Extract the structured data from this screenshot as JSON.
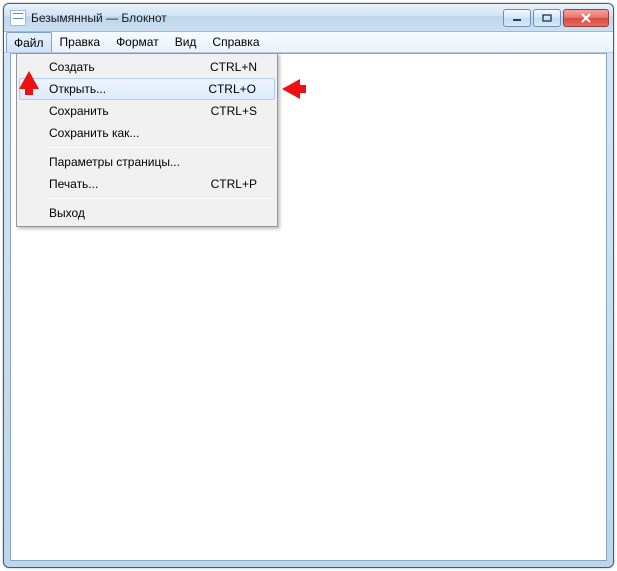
{
  "window": {
    "title": "Безымянный — Блокнот"
  },
  "menubar": {
    "items": [
      {
        "label": "Файл"
      },
      {
        "label": "Правка"
      },
      {
        "label": "Формат"
      },
      {
        "label": "Вид"
      },
      {
        "label": "Справка"
      }
    ]
  },
  "file_menu": {
    "items": [
      {
        "label": "Создать",
        "shortcut": "CTRL+N"
      },
      {
        "label": "Открыть...",
        "shortcut": "CTRL+O",
        "hover": true
      },
      {
        "label": "Сохранить",
        "shortcut": "CTRL+S"
      },
      {
        "label": "Сохранить как...",
        "shortcut": ""
      }
    ],
    "items2": [
      {
        "label": "Параметры страницы...",
        "shortcut": ""
      },
      {
        "label": "Печать...",
        "shortcut": "CTRL+P"
      }
    ],
    "items3": [
      {
        "label": "Выход",
        "shortcut": ""
      }
    ]
  }
}
